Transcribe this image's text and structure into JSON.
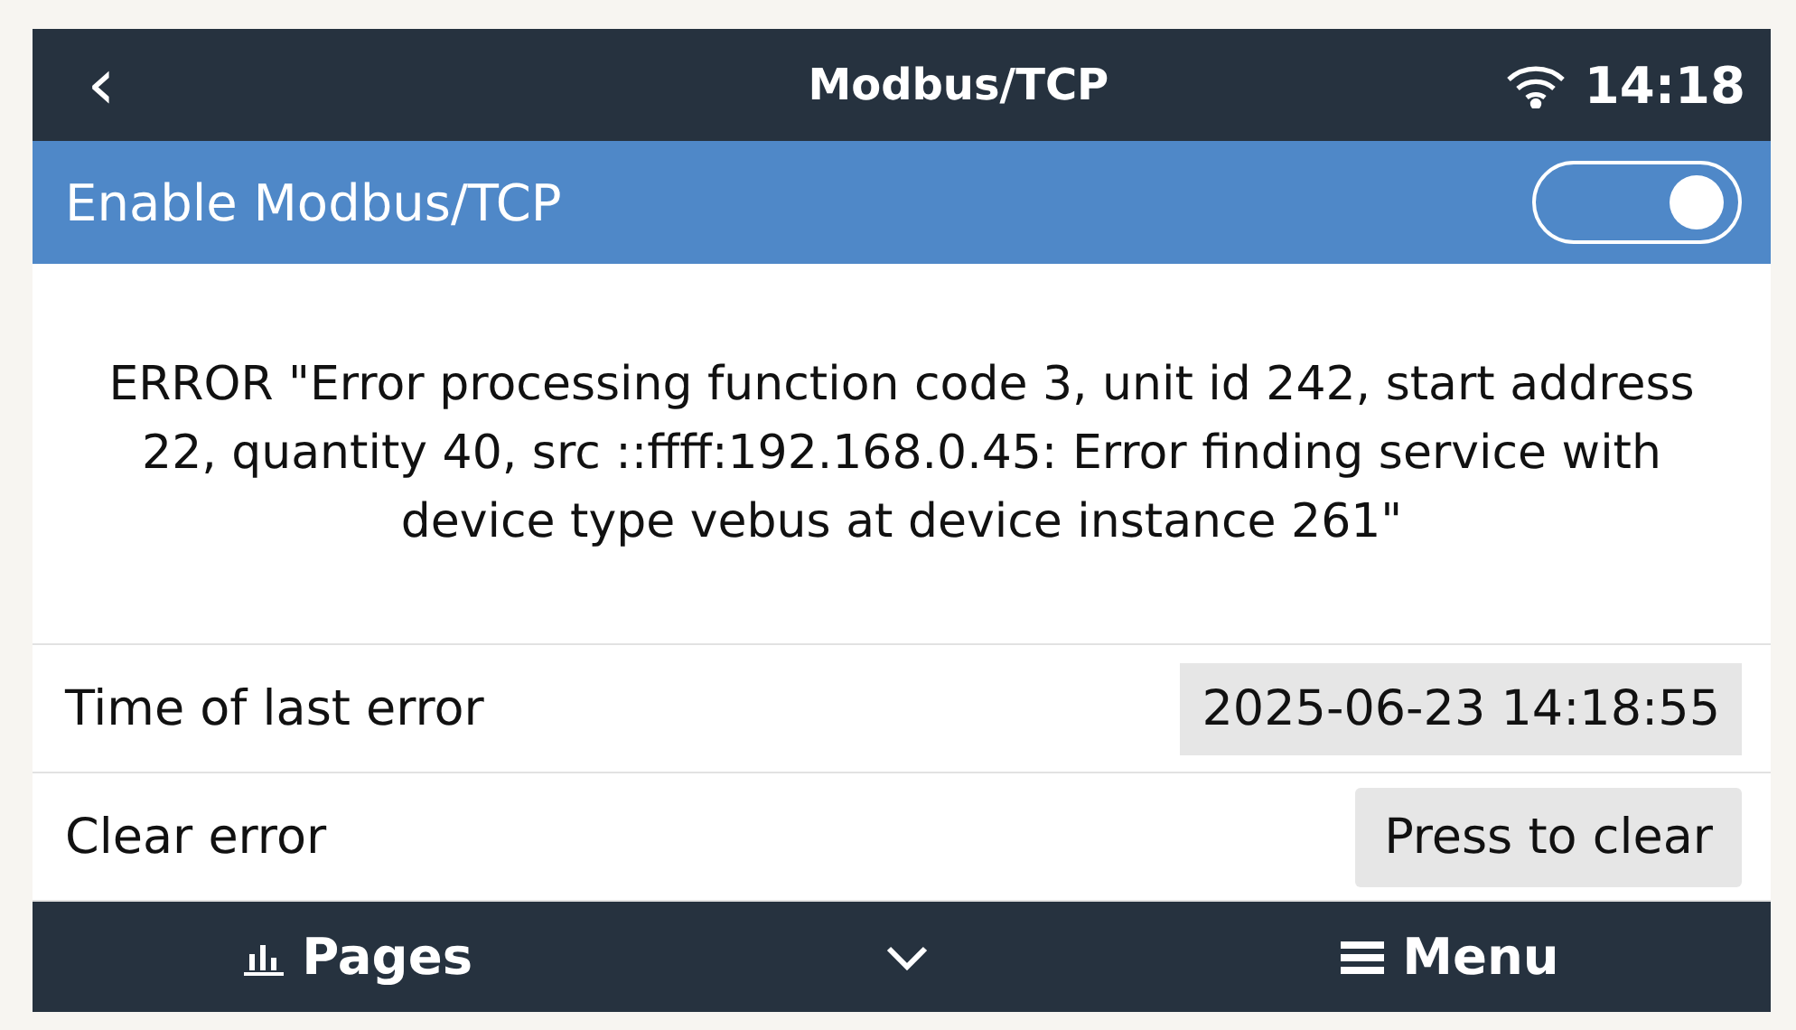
{
  "header": {
    "back": "‹",
    "title": "Modbus/TCP",
    "time": "14:18"
  },
  "enable": {
    "label": "Enable Modbus/TCP",
    "on": true
  },
  "error_message": "ERROR \"Error processing function code 3, unit id 242, start address 22, quantity 40, src ::ffff:192.168.0.45: Error finding service with device type vebus at device instance 261\"",
  "rows": [
    {
      "kind": "value",
      "label": "Time of last error",
      "value": "2025-06-23 14:18:55"
    },
    {
      "kind": "button",
      "label": "Clear error",
      "value": "Press to clear"
    }
  ],
  "footer": {
    "pages": "Pages",
    "menu": "Menu"
  }
}
